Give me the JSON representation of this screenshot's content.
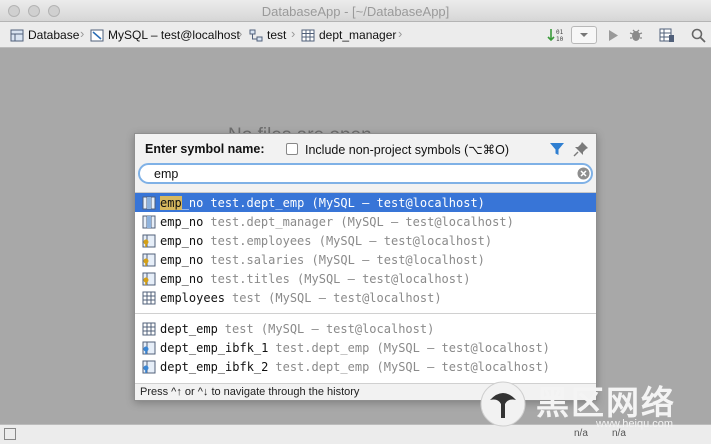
{
  "window": {
    "title": "DatabaseApp - [~/DatabaseApp]"
  },
  "breadcrumbs": [
    {
      "label": "Database",
      "icon": "database-icon"
    },
    {
      "label": "MySQL – test@localhost",
      "icon": "mysql-icon"
    },
    {
      "label": "test",
      "icon": "schema-icon"
    },
    {
      "label": "dept_manager",
      "icon": "table-icon"
    }
  ],
  "editor": {
    "empty_message": "No files are open"
  },
  "popup": {
    "prompt": "Enter symbol name:",
    "include_label": "Include non-project symbols (⌥⌘O)",
    "search_value": "emp",
    "results": [
      {
        "name": "emp_no",
        "context": "test.dept_emp (MySQL – test@localhost)",
        "icon": "column-icon",
        "selected": true
      },
      {
        "name": "emp_no",
        "context": "test.dept_manager (MySQL – test@localhost)",
        "icon": "column-icon"
      },
      {
        "name": "emp_no",
        "context": "test.employees (MySQL – test@localhost)",
        "icon": "key-column-icon"
      },
      {
        "name": "emp_no",
        "context": "test.salaries (MySQL – test@localhost)",
        "icon": "key-column-icon"
      },
      {
        "name": "emp_no",
        "context": "test.titles (MySQL – test@localhost)",
        "icon": "key-column-icon"
      },
      {
        "name": "employees",
        "context": "test (MySQL – test@localhost)",
        "icon": "table-icon"
      },
      {
        "name": "dept_emp",
        "context": "test (MySQL – test@localhost)",
        "icon": "table-icon"
      },
      {
        "name": "dept_emp_ibfk_1",
        "context": "test.dept_emp (MySQL – test@localhost)",
        "icon": "foreign-key-icon"
      },
      {
        "name": "dept_emp_ibfk_2",
        "context": "test.dept_emp (MySQL – test@localhost)",
        "icon": "foreign-key-icon"
      }
    ],
    "hint": "Press ^↑ or ^↓ to navigate through the history"
  },
  "statusbar": {
    "left": "n/a",
    "right": "n/a"
  },
  "watermark": {
    "text": "黑区网络",
    "url": "www.heiqu.com"
  }
}
